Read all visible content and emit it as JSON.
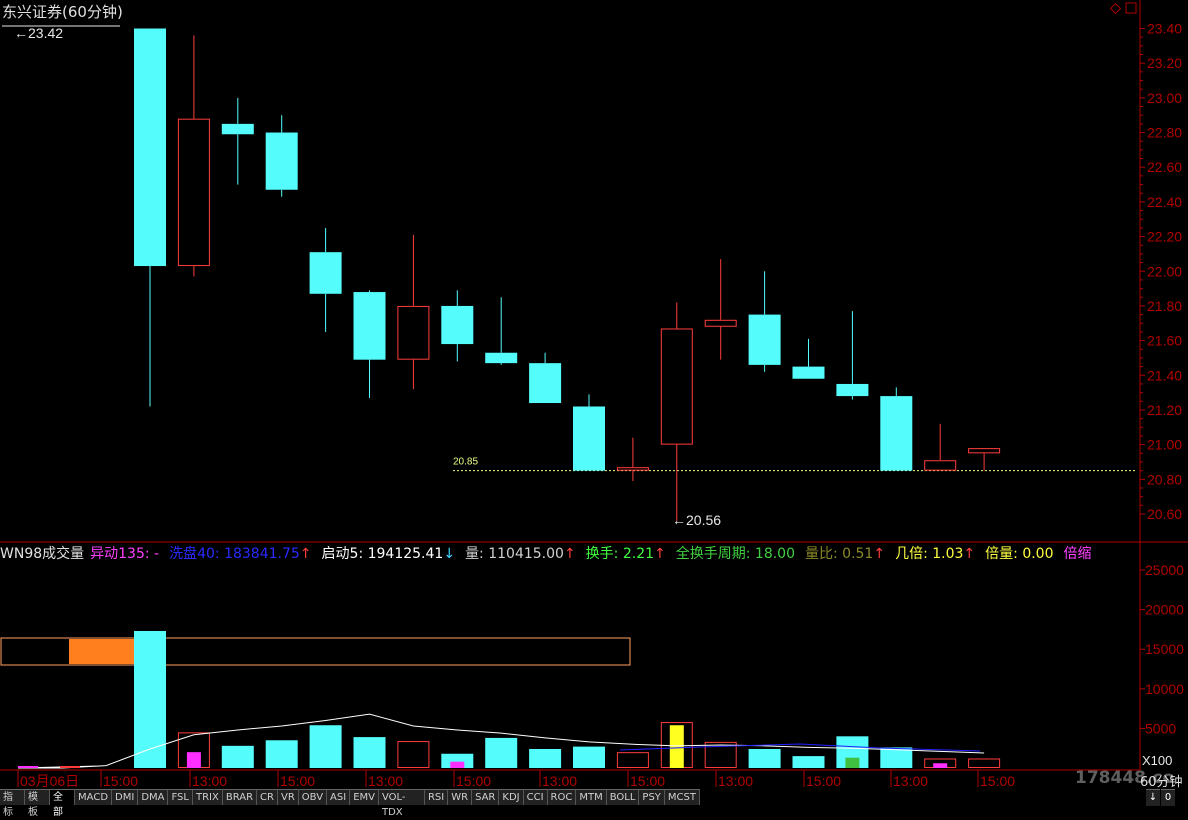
{
  "header": {
    "title": "东兴证券(60分钟)",
    "high_label": "23.42",
    "low_label": "20.56",
    "ref_line_label": "20.85"
  },
  "colors": {
    "up": "#ff3c3c",
    "down": "#54fcfc",
    "axis": "#b00000",
    "ref_line": "#e8ff8a",
    "volume_ma": "#ffffff",
    "volume_ma2": "#2020ff"
  },
  "indicator_row": {
    "name": "WN98成交量",
    "items": [
      {
        "label": "异动135:",
        "value": "-",
        "color": "#ff40ff"
      },
      {
        "label": "洗盘40:",
        "value": "183841.75",
        "arrow": "↑",
        "color": "#2a2aff"
      },
      {
        "label": "启动5:",
        "value": "194125.41",
        "arrow": "↓",
        "color": "#ffffff"
      },
      {
        "label": "量:",
        "value": "110415.00",
        "arrow": "↑",
        "color": "#d0d0d0"
      },
      {
        "label": "换手:",
        "value": "2.21",
        "arrow": "↑",
        "color": "#40ff40"
      },
      {
        "label": "全换手周期:",
        "value": "18.00",
        "color": "#40d040"
      },
      {
        "label": "量比:",
        "value": "0.51",
        "arrow": "↑",
        "color": "#8a8a2a"
      },
      {
        "label": "几倍:",
        "value": "1.03",
        "arrow": "↑",
        "color": "#ffff40"
      },
      {
        "label": "倍量:",
        "value": "0.00",
        "color": "#ffff40"
      },
      {
        "label": "倍缩",
        "value": "",
        "color": "#ff40ff"
      }
    ]
  },
  "chart_data": [
    {
      "type": "candlestick",
      "title": "东兴证券(60分钟)",
      "ylim": [
        20.45,
        23.5
      ],
      "yticks": [
        "23.40",
        "23.20",
        "23.00",
        "22.80",
        "22.60",
        "22.40",
        "22.20",
        "22.00",
        "21.80",
        "21.60",
        "21.40",
        "21.20",
        "21.00",
        "20.80",
        "20.60"
      ],
      "reference_line": 20.85,
      "candles": [
        {
          "open": 23.4,
          "close": 22.03,
          "high": 23.4,
          "low": 21.22
        },
        {
          "open": 22.03,
          "close": 22.88,
          "high": 23.36,
          "low": 21.97
        },
        {
          "open": 22.85,
          "close": 22.79,
          "high": 23.0,
          "low": 22.5
        },
        {
          "open": 22.8,
          "close": 22.47,
          "high": 22.9,
          "low": 22.43
        },
        {
          "open": 22.11,
          "close": 21.87,
          "high": 22.25,
          "low": 21.65
        },
        {
          "open": 21.88,
          "close": 21.49,
          "high": 21.89,
          "low": 21.27
        },
        {
          "open": 21.49,
          "close": 21.8,
          "high": 22.21,
          "low": 21.32
        },
        {
          "open": 21.8,
          "close": 21.58,
          "high": 21.89,
          "low": 21.48
        },
        {
          "open": 21.53,
          "close": 21.47,
          "high": 21.85,
          "low": 21.46
        },
        {
          "open": 21.47,
          "close": 21.24,
          "high": 21.53,
          "low": 21.24
        },
        {
          "open": 21.22,
          "close": 20.85,
          "high": 21.29,
          "low": 20.85
        },
        {
          "open": 20.85,
          "close": 20.87,
          "high": 21.04,
          "low": 20.79
        },
        {
          "open": 21.0,
          "close": 21.67,
          "high": 21.82,
          "low": 20.56
        },
        {
          "open": 21.68,
          "close": 21.72,
          "high": 22.07,
          "low": 21.49
        },
        {
          "open": 21.75,
          "close": 21.46,
          "high": 22.0,
          "low": 21.42
        },
        {
          "open": 21.45,
          "close": 21.38,
          "high": 21.61,
          "low": 21.38
        },
        {
          "open": 21.35,
          "close": 21.28,
          "high": 21.77,
          "low": 21.26
        },
        {
          "open": 21.28,
          "close": 20.85,
          "high": 21.33,
          "low": 20.85
        },
        {
          "open": 20.85,
          "close": 20.91,
          "high": 21.12,
          "low": 20.85
        },
        {
          "open": 20.95,
          "close": 20.98,
          "high": 20.98,
          "low": 20.85
        }
      ]
    },
    {
      "type": "bar",
      "title": "WN98成交量",
      "unit": "X100",
      "ylim": [
        0,
        28000
      ],
      "yticks": [
        "25000",
        "20000",
        "15000",
        "10000",
        "5000"
      ],
      "values": [
        0,
        0,
        0,
        17300,
        4500,
        2800,
        3500,
        5400,
        3900,
        3400,
        1800,
        3800,
        2400,
        2700,
        2000,
        5800,
        3300,
        2400,
        1500,
        4000,
        2600,
        1200,
        1200
      ],
      "directions": [
        "down",
        "down",
        "down",
        "down",
        "up",
        "down",
        "down",
        "down",
        "down",
        "up",
        "down",
        "down",
        "down",
        "down",
        "up",
        "up",
        "up",
        "down",
        "down",
        "down",
        "down",
        "up",
        "up"
      ],
      "ma_line": [
        0,
        0,
        300,
        2400,
        4200,
        4800,
        5300,
        6000,
        6800,
        5300,
        4800,
        4400,
        3800,
        3300,
        3000,
        2800,
        2900,
        2800,
        2600,
        2500,
        2300,
        2100,
        1900
      ],
      "highlight_box_range": [
        0,
        15000,
        12000
      ],
      "x_tick_labels": [
        "03月06日",
        "15:00",
        "13:00",
        "15:00",
        "13:00",
        "15:00",
        "13:00",
        "15:00",
        "13:00",
        "15:00",
        "13:00",
        "15:00"
      ]
    }
  ],
  "bottom_tabs": [
    "指标",
    "模板",
    "全部",
    "MACD",
    "DMI",
    "DMA",
    "FSL",
    "TRIX",
    "BRAR",
    "CR",
    "VR",
    "OBV",
    "ASI",
    "EMV",
    "VOL-TDX",
    "RSI",
    "WR",
    "SAR",
    "KDJ",
    "CCI",
    "ROC",
    "MTM",
    "BOLL",
    "PSY",
    "MCST"
  ],
  "watermark": "178448.co",
  "cycle_label": "60分钟",
  "bottom_right": [
    "↓",
    "0"
  ]
}
